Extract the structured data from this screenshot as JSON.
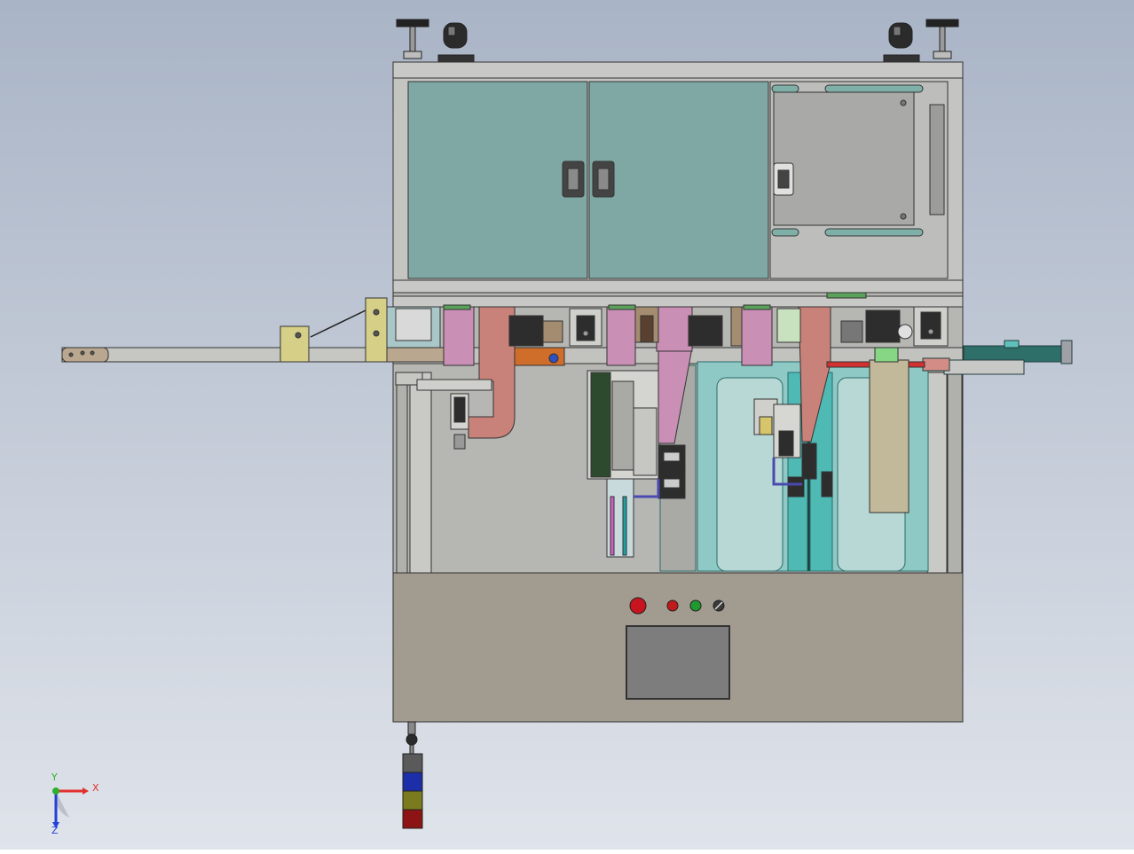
{
  "viewport": {
    "background_top": "#a9b4c6",
    "background_bottom": "#dfe3ea"
  },
  "triad": {
    "x_label": "X",
    "y_label": "Y",
    "z_label": "Z",
    "x_color": "#e23030",
    "y_color": "#2fae2f",
    "z_color": "#2340d8"
  },
  "control_panel": {
    "buttons": [
      {
        "name": "emergency-stop-button",
        "color": "#c8141e"
      },
      {
        "name": "stop-button",
        "color": "#c21a1a"
      },
      {
        "name": "start-button",
        "color": "#1e9a2e"
      },
      {
        "name": "selector-switch",
        "color": "#3a3a3a"
      }
    ],
    "screen_color": "#7d7d7d"
  },
  "signal_tower": {
    "segments": [
      "#5a5a5a",
      "#1c2fa8",
      "#7a7a1e",
      "#8c1414"
    ]
  },
  "colors": {
    "frame": "#c4c4c0",
    "cabinet_door": "#7fa8a4",
    "base_panel": "#a29b8f",
    "pink_part": "#c98fb5",
    "salmon_part": "#c98279",
    "teal_part": "#4fb9b4",
    "conveyor": "#2f6f6a"
  }
}
